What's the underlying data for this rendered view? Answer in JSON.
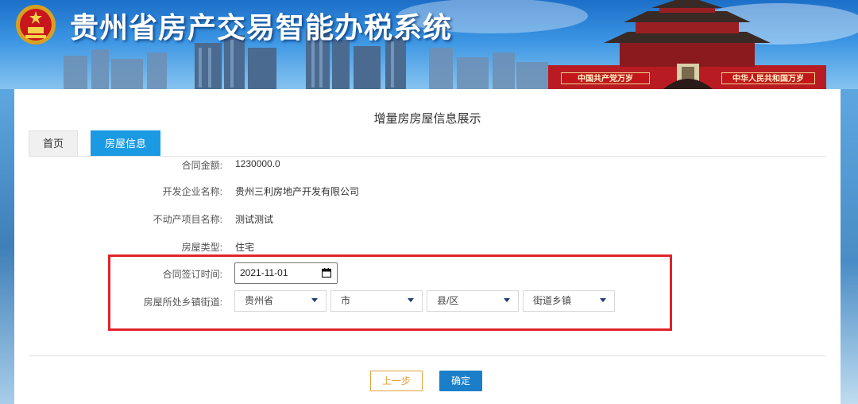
{
  "header": {
    "system_title": "贵州省房产交易智能办税系统",
    "slogan_left": "中国共产党万岁",
    "slogan_right": "中华人民共和国万岁"
  },
  "page": {
    "title": "增量房房屋信息展示"
  },
  "tabs": [
    {
      "label": "首页",
      "active": false
    },
    {
      "label": "房屋信息",
      "active": true
    }
  ],
  "fields": {
    "contract_amount": {
      "label": "合同金额:",
      "value": "1230000.0"
    },
    "developer_name": {
      "label": "开发企业名称:",
      "value": "贵州三利房地产开发有限公司"
    },
    "project_name": {
      "label": "不动产项目名称:",
      "value": "测试测试"
    },
    "house_type": {
      "label": "房屋类型:",
      "value": "住宅"
    },
    "sign_date": {
      "label": "合同签订时间:",
      "value": "2021-11-01"
    },
    "location": {
      "label": "房屋所处乡镇街道:",
      "province": "贵州省",
      "city": "市",
      "district": "县/区",
      "street": "街道乡镇"
    }
  },
  "buttons": {
    "prev": "上一步",
    "confirm": "确定"
  },
  "colors": {
    "accent_blue": "#1b9ae4",
    "confirm_blue": "#1a7fc8",
    "prev_orange": "#e0a23c",
    "highlight_red": "#e0242a"
  }
}
